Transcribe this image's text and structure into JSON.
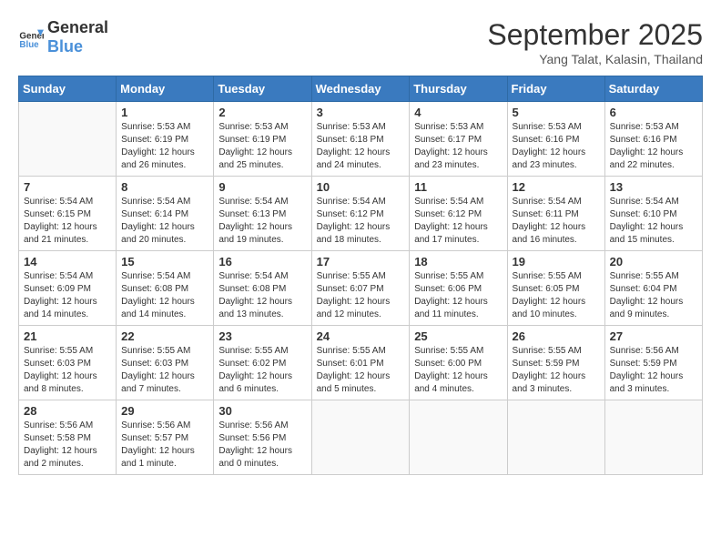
{
  "header": {
    "logo_line1": "General",
    "logo_line2": "Blue",
    "month_title": "September 2025",
    "location": "Yang Talat, Kalasin, Thailand"
  },
  "days_of_week": [
    "Sunday",
    "Monday",
    "Tuesday",
    "Wednesday",
    "Thursday",
    "Friday",
    "Saturday"
  ],
  "weeks": [
    [
      {
        "day": "",
        "info": ""
      },
      {
        "day": "1",
        "info": "Sunrise: 5:53 AM\nSunset: 6:19 PM\nDaylight: 12 hours\nand 26 minutes."
      },
      {
        "day": "2",
        "info": "Sunrise: 5:53 AM\nSunset: 6:19 PM\nDaylight: 12 hours\nand 25 minutes."
      },
      {
        "day": "3",
        "info": "Sunrise: 5:53 AM\nSunset: 6:18 PM\nDaylight: 12 hours\nand 24 minutes."
      },
      {
        "day": "4",
        "info": "Sunrise: 5:53 AM\nSunset: 6:17 PM\nDaylight: 12 hours\nand 23 minutes."
      },
      {
        "day": "5",
        "info": "Sunrise: 5:53 AM\nSunset: 6:16 PM\nDaylight: 12 hours\nand 23 minutes."
      },
      {
        "day": "6",
        "info": "Sunrise: 5:53 AM\nSunset: 6:16 PM\nDaylight: 12 hours\nand 22 minutes."
      }
    ],
    [
      {
        "day": "7",
        "info": "Sunrise: 5:54 AM\nSunset: 6:15 PM\nDaylight: 12 hours\nand 21 minutes."
      },
      {
        "day": "8",
        "info": "Sunrise: 5:54 AM\nSunset: 6:14 PM\nDaylight: 12 hours\nand 20 minutes."
      },
      {
        "day": "9",
        "info": "Sunrise: 5:54 AM\nSunset: 6:13 PM\nDaylight: 12 hours\nand 19 minutes."
      },
      {
        "day": "10",
        "info": "Sunrise: 5:54 AM\nSunset: 6:12 PM\nDaylight: 12 hours\nand 18 minutes."
      },
      {
        "day": "11",
        "info": "Sunrise: 5:54 AM\nSunset: 6:12 PM\nDaylight: 12 hours\nand 17 minutes."
      },
      {
        "day": "12",
        "info": "Sunrise: 5:54 AM\nSunset: 6:11 PM\nDaylight: 12 hours\nand 16 minutes."
      },
      {
        "day": "13",
        "info": "Sunrise: 5:54 AM\nSunset: 6:10 PM\nDaylight: 12 hours\nand 15 minutes."
      }
    ],
    [
      {
        "day": "14",
        "info": "Sunrise: 5:54 AM\nSunset: 6:09 PM\nDaylight: 12 hours\nand 14 minutes."
      },
      {
        "day": "15",
        "info": "Sunrise: 5:54 AM\nSunset: 6:08 PM\nDaylight: 12 hours\nand 14 minutes."
      },
      {
        "day": "16",
        "info": "Sunrise: 5:54 AM\nSunset: 6:08 PM\nDaylight: 12 hours\nand 13 minutes."
      },
      {
        "day": "17",
        "info": "Sunrise: 5:55 AM\nSunset: 6:07 PM\nDaylight: 12 hours\nand 12 minutes."
      },
      {
        "day": "18",
        "info": "Sunrise: 5:55 AM\nSunset: 6:06 PM\nDaylight: 12 hours\nand 11 minutes."
      },
      {
        "day": "19",
        "info": "Sunrise: 5:55 AM\nSunset: 6:05 PM\nDaylight: 12 hours\nand 10 minutes."
      },
      {
        "day": "20",
        "info": "Sunrise: 5:55 AM\nSunset: 6:04 PM\nDaylight: 12 hours\nand 9 minutes."
      }
    ],
    [
      {
        "day": "21",
        "info": "Sunrise: 5:55 AM\nSunset: 6:03 PM\nDaylight: 12 hours\nand 8 minutes."
      },
      {
        "day": "22",
        "info": "Sunrise: 5:55 AM\nSunset: 6:03 PM\nDaylight: 12 hours\nand 7 minutes."
      },
      {
        "day": "23",
        "info": "Sunrise: 5:55 AM\nSunset: 6:02 PM\nDaylight: 12 hours\nand 6 minutes."
      },
      {
        "day": "24",
        "info": "Sunrise: 5:55 AM\nSunset: 6:01 PM\nDaylight: 12 hours\nand 5 minutes."
      },
      {
        "day": "25",
        "info": "Sunrise: 5:55 AM\nSunset: 6:00 PM\nDaylight: 12 hours\nand 4 minutes."
      },
      {
        "day": "26",
        "info": "Sunrise: 5:55 AM\nSunset: 5:59 PM\nDaylight: 12 hours\nand 3 minutes."
      },
      {
        "day": "27",
        "info": "Sunrise: 5:56 AM\nSunset: 5:59 PM\nDaylight: 12 hours\nand 3 minutes."
      }
    ],
    [
      {
        "day": "28",
        "info": "Sunrise: 5:56 AM\nSunset: 5:58 PM\nDaylight: 12 hours\nand 2 minutes."
      },
      {
        "day": "29",
        "info": "Sunrise: 5:56 AM\nSunset: 5:57 PM\nDaylight: 12 hours\nand 1 minute."
      },
      {
        "day": "30",
        "info": "Sunrise: 5:56 AM\nSunset: 5:56 PM\nDaylight: 12 hours\nand 0 minutes."
      },
      {
        "day": "",
        "info": ""
      },
      {
        "day": "",
        "info": ""
      },
      {
        "day": "",
        "info": ""
      },
      {
        "day": "",
        "info": ""
      }
    ]
  ]
}
